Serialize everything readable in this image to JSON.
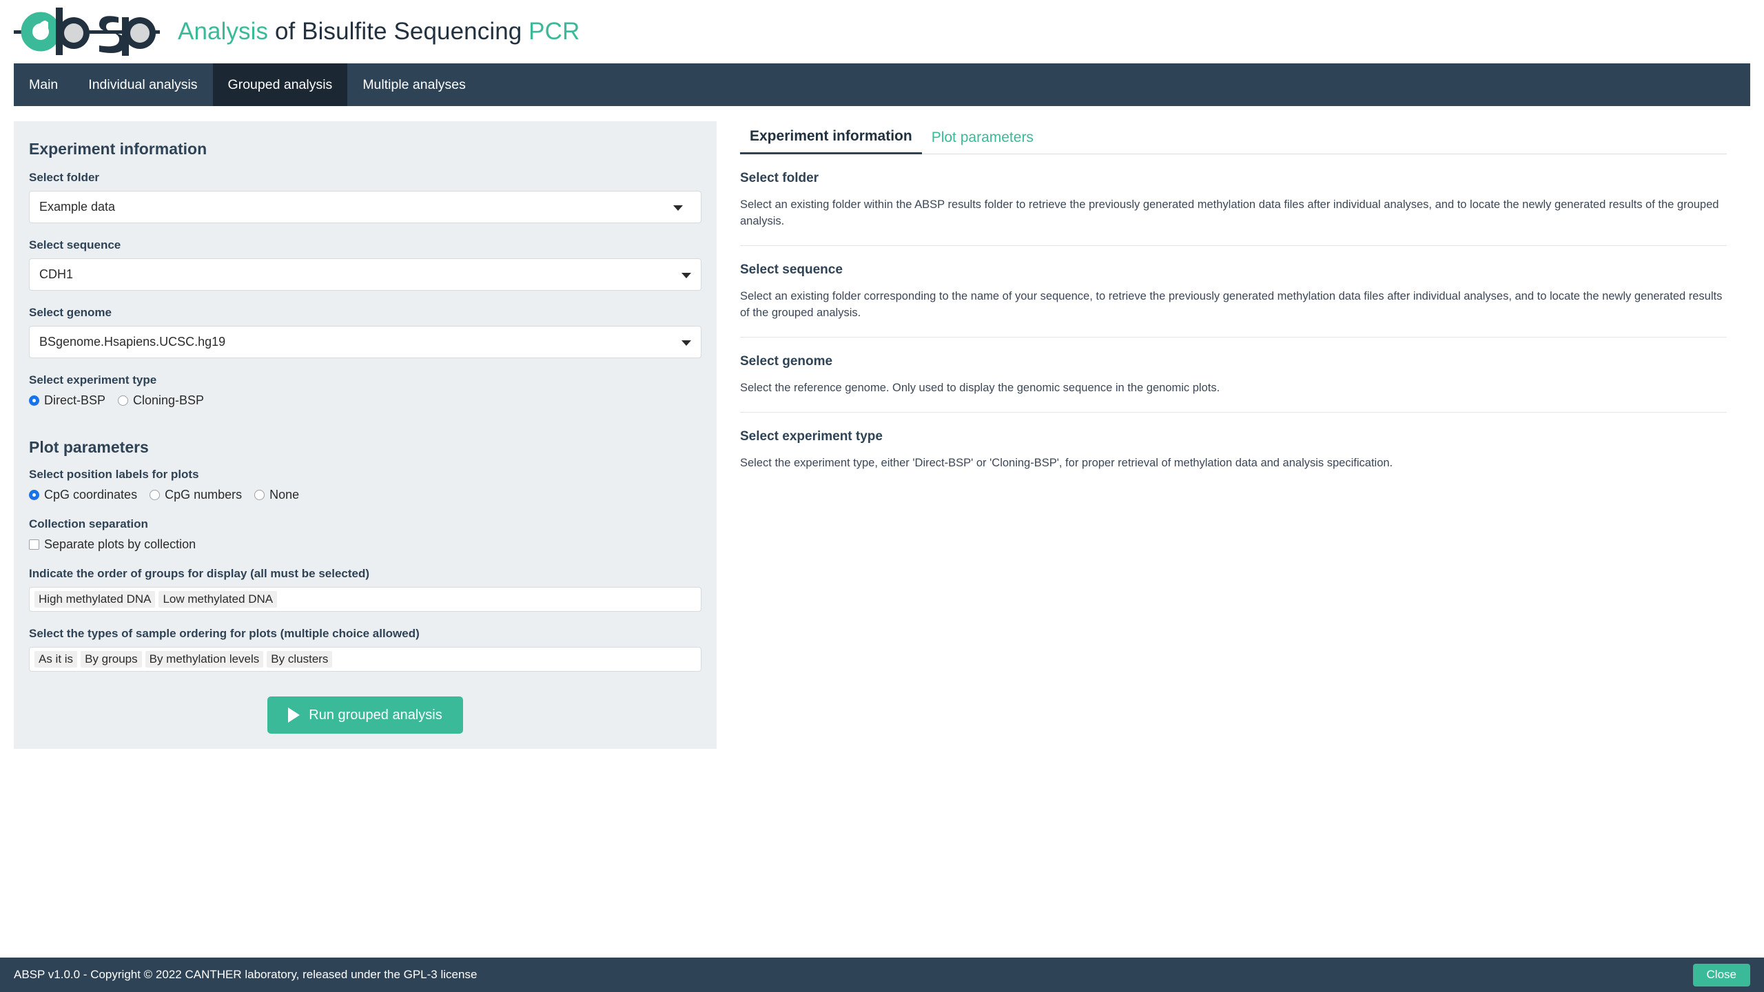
{
  "brand": {
    "logo_icon": "absp-logo",
    "title_accent_1": "Analysis",
    "title_dark": " of Bisulfite Sequencing ",
    "title_accent_2": "PCR"
  },
  "nav": {
    "items": [
      {
        "label": "Main",
        "active": false
      },
      {
        "label": "Individual analysis",
        "active": false
      },
      {
        "label": "Grouped analysis",
        "active": true
      },
      {
        "label": "Multiple analyses",
        "active": false
      }
    ]
  },
  "sidebar": {
    "experiment_heading": "Experiment information",
    "folder_label": "Select folder",
    "folder_value": "Example data",
    "sequence_label": "Select sequence",
    "sequence_value": "CDH1",
    "genome_label": "Select genome",
    "genome_value": "BSgenome.Hsapiens.UCSC.hg19",
    "experiment_type_label": "Select experiment type",
    "experiment_type_options": [
      {
        "label": "Direct-BSP",
        "selected": true
      },
      {
        "label": "Cloning-BSP",
        "selected": false
      }
    ],
    "plot_heading": "Plot parameters",
    "position_labels_label": "Select position labels for plots",
    "position_labels_options": [
      {
        "label": "CpG coordinates",
        "selected": true
      },
      {
        "label": "CpG numbers",
        "selected": false
      },
      {
        "label": "None",
        "selected": false
      }
    ],
    "collection_separation_label": "Collection separation",
    "separate_plots_label": "Separate plots by collection",
    "separate_plots_checked": false,
    "group_order_label": "Indicate the order of groups for display (all must be selected)",
    "group_order_tags": [
      "High methylated DNA",
      "Low methylated DNA"
    ],
    "sample_ordering_label": "Select the types of sample ordering for plots (multiple choice allowed)",
    "sample_ordering_tags": [
      "As it is",
      "By groups",
      "By methylation levels",
      "By clusters"
    ],
    "run_button_label": "Run grouped analysis",
    "run_button_icon": "play-icon",
    "run_button_color": "#3aba99"
  },
  "help": {
    "tabs": [
      {
        "label": "Experiment information",
        "active": true
      },
      {
        "label": "Plot parameters",
        "active": false
      }
    ],
    "sections": [
      {
        "title": "Select folder",
        "text": "Select an existing folder within the ABSP results folder to retrieve the previously generated methylation data files after individual analyses, and to locate the newly generated results of the grouped analysis."
      },
      {
        "title": "Select sequence",
        "text": "Select an existing folder corresponding to the name of your sequence, to retrieve the previously generated methylation data files after individual analyses, and to locate the newly generated results of the grouped analysis."
      },
      {
        "title": "Select genome",
        "text": "Select the reference genome. Only used to display the genomic sequence in the genomic plots."
      },
      {
        "title": "Select experiment type",
        "text": "Select the experiment type, either 'Direct-BSP' or 'Cloning-BSP', for proper retrieval of methylation data and analysis specification."
      }
    ]
  },
  "footer": {
    "text": "ABSP v1.0.0 - Copyright © 2022 CANTHER laboratory, released under the GPL-3 license",
    "close_label": "Close"
  },
  "colors": {
    "accent_teal": "#3aba99",
    "navy": "#2f4356",
    "navy_dark": "#1b2733",
    "panel_bg": "#eceff1",
    "radio_blue": "#1a73e8"
  }
}
